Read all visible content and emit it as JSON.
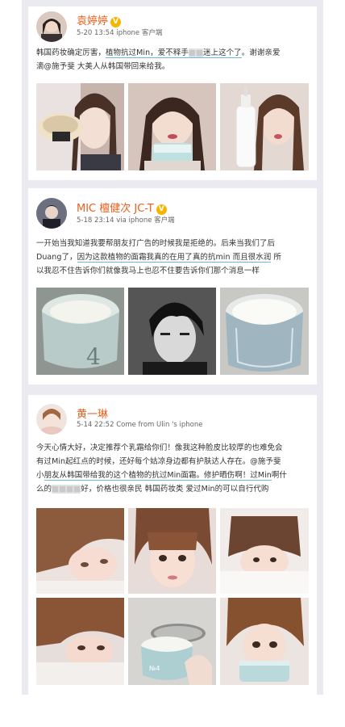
{
  "posts": [
    {
      "author": "袁婷婷",
      "verified": "V",
      "time": "5-20 13:54",
      "client": "iphone 客户端",
      "lines": [
        {
          "pre": "韩国药妆确定厉害，",
          "hl": "植物抗过Min，爱不释手",
          "blur": "■■",
          "hl2": "迷上这个了",
          "post": "。谢谢亲爱"
        },
        {
          "pre": "滴@施予斐 大美人从韩国带回来给我。",
          "hl": "",
          "blur": "",
          "hl2": "",
          "post": ""
        }
      ],
      "photos": [
        "selfie-with-compact",
        "selfie-with-cream-jar",
        "selfie-with-lotion-bottle"
      ]
    },
    {
      "author": "MIC 檀健次 JC-T",
      "verified": "V",
      "time": "5-18 23:14",
      "client": "via iphone 客户端",
      "lines": [
        {
          "pre": "一开始当我知道我要帮朋友打广告的时候我是拒绝的。后来当我们了后",
          "hl": "",
          "post": ""
        },
        {
          "pre": "Duang了，",
          "hl": "因为这款植物的面霜我真的在用了真的抗min 而且很水润",
          "post": " 所"
        },
        {
          "pre": "以我忍不住告诉你们就像我马上也忍不住要告诉你们那个消息一样",
          "hl": "",
          "post": ""
        }
      ],
      "photos": [
        "cream-jar-open",
        "bw-portrait",
        "cream-jar-texture"
      ]
    },
    {
      "author": "黄一琳",
      "verified": "",
      "time": "5-14 22:52",
      "client": "Come from  Ulin 's iphone",
      "lines": [
        {
          "pre": "今天心情大好，决定推荐个乳霜给你们！像我这种脸皮比较厚的也难免会",
          "hl": "",
          "post": ""
        },
        {
          "pre": "有过Min起红点的时候，还好每个姑凉身边都有护肤达人存在。@施予斐",
          "hl": "",
          "post": ""
        },
        {
          "pre": "小",
          "hl": "朋友从韩国带给我的这个植物的抗过Min面霜。修护晒伤啊！过Min",
          "post": "啊什"
        },
        {
          "pre": "么的",
          "blur": "■■■■",
          "post": "好，价格也很亲民 韩国药妆类 爱过Min的可以自行代购"
        }
      ],
      "photos": [
        "selfie-1",
        "selfie-2",
        "selfie-3",
        "selfie-4",
        "cream-jar-hand",
        "selfie-5"
      ]
    }
  ]
}
